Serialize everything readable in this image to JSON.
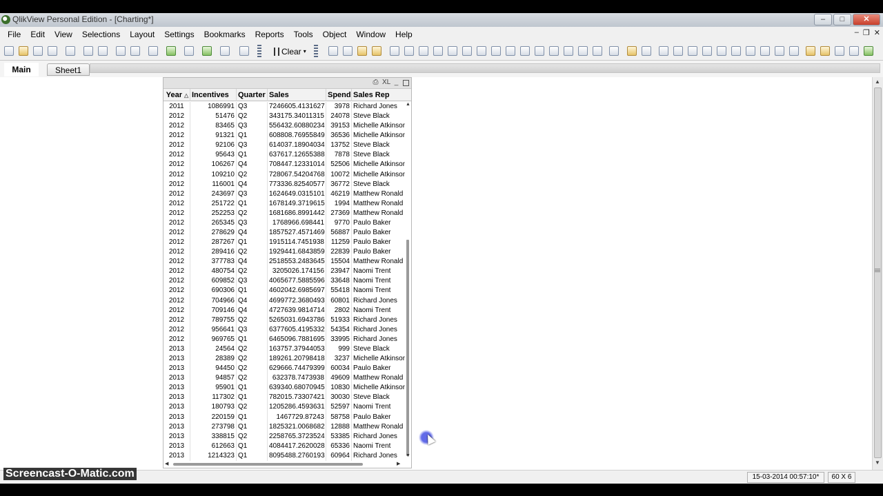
{
  "window": {
    "title": "QlikView Personal Edition - [Charting*]",
    "buttons": {
      "minimize": "–",
      "maximize": "□",
      "close": "✕"
    }
  },
  "menu": {
    "items": [
      "File",
      "Edit",
      "View",
      "Selections",
      "Layout",
      "Settings",
      "Bookmarks",
      "Reports",
      "Tools",
      "Object",
      "Window",
      "Help"
    ],
    "mdi": {
      "minimize": "–",
      "restore": "❐",
      "close": "✕"
    }
  },
  "toolbar": {
    "clear_label": "Clear",
    "clear_arrow": "▾"
  },
  "tabs": {
    "main": "Main",
    "sheet1": "Sheet1"
  },
  "table": {
    "caption_icons": {
      "xl": "XL",
      "minimize": "_"
    },
    "sort_icon": "△",
    "headers": [
      "Year",
      "Incentives",
      "Quarter",
      "Sales",
      "Spend",
      "Sales Rep"
    ],
    "rows": [
      [
        "2011",
        "1086991",
        "Q3",
        "7246605.4131627",
        "3978",
        "Richard Jones"
      ],
      [
        "2012",
        "51476",
        "Q2",
        "343175.34011315",
        "24078",
        "Steve Black"
      ],
      [
        "2012",
        "83465",
        "Q3",
        "556432.60880234",
        "39153",
        "Michelle Atkinson"
      ],
      [
        "2012",
        "91321",
        "Q1",
        "608808.76955849",
        "36536",
        "Michelle Atkinson"
      ],
      [
        "2012",
        "92106",
        "Q3",
        "614037.18904034",
        "13752",
        "Steve Black"
      ],
      [
        "2012",
        "95643",
        "Q1",
        "637617.12655388",
        "7878",
        "Steve Black"
      ],
      [
        "2012",
        "106267",
        "Q4",
        "708447.12331014",
        "52506",
        "Michelle Atkinson"
      ],
      [
        "2012",
        "109210",
        "Q2",
        "728067.54204768",
        "10072",
        "Michelle Atkinson"
      ],
      [
        "2012",
        "116001",
        "Q4",
        "773336.82540577",
        "36772",
        "Steve Black"
      ],
      [
        "2012",
        "243697",
        "Q3",
        "1624649.0315101",
        "46219",
        "Matthew Ronald"
      ],
      [
        "2012",
        "251722",
        "Q1",
        "1678149.3719615",
        "1994",
        "Matthew Ronald"
      ],
      [
        "2012",
        "252253",
        "Q2",
        "1681686.8991442",
        "27369",
        "Matthew Ronald"
      ],
      [
        "2012",
        "265345",
        "Q3",
        "1768966.698441",
        "9770",
        "Paulo Baker"
      ],
      [
        "2012",
        "278629",
        "Q4",
        "1857527.4571469",
        "56887",
        "Paulo Baker"
      ],
      [
        "2012",
        "287267",
        "Q1",
        "1915114.7451938",
        "11259",
        "Paulo Baker"
      ],
      [
        "2012",
        "289416",
        "Q2",
        "1929441.6843859",
        "22839",
        "Paulo Baker"
      ],
      [
        "2012",
        "377783",
        "Q4",
        "2518553.2483645",
        "15504",
        "Matthew Ronald"
      ],
      [
        "2012",
        "480754",
        "Q2",
        "3205026.174156",
        "23947",
        "Naomi Trent"
      ],
      [
        "2012",
        "609852",
        "Q3",
        "4065677.5885596",
        "33648",
        "Naomi Trent"
      ],
      [
        "2012",
        "690306",
        "Q1",
        "4602042.6985697",
        "55418",
        "Naomi Trent"
      ],
      [
        "2012",
        "704966",
        "Q4",
        "4699772.3680493",
        "60801",
        "Richard Jones"
      ],
      [
        "2012",
        "709146",
        "Q4",
        "4727639.9814714",
        "2802",
        "Naomi Trent"
      ],
      [
        "2012",
        "789755",
        "Q2",
        "5265031.6943786",
        "51933",
        "Richard Jones"
      ],
      [
        "2012",
        "956641",
        "Q3",
        "6377605.4195332",
        "54354",
        "Richard Jones"
      ],
      [
        "2012",
        "969765",
        "Q1",
        "6465096.7881695",
        "33995",
        "Richard Jones"
      ],
      [
        "2013",
        "24564",
        "Q2",
        "163757.37944053",
        "999",
        "Steve Black"
      ],
      [
        "2013",
        "28389",
        "Q2",
        "189261.20798418",
        "3237",
        "Michelle Atkinson"
      ],
      [
        "2013",
        "94450",
        "Q2",
        "629666.74479399",
        "60034",
        "Paulo Baker"
      ],
      [
        "2013",
        "94857",
        "Q2",
        "632378.7473938",
        "49609",
        "Matthew Ronald"
      ],
      [
        "2013",
        "95901",
        "Q1",
        "639340.68070945",
        "10830",
        "Michelle Atkinson"
      ],
      [
        "2013",
        "117302",
        "Q1",
        "782015.73307421",
        "30030",
        "Steve Black"
      ],
      [
        "2013",
        "180793",
        "Q2",
        "1205286.4593631",
        "52597",
        "Naomi Trent"
      ],
      [
        "2013",
        "220159",
        "Q1",
        "1467729.87243",
        "58758",
        "Paulo Baker"
      ],
      [
        "2013",
        "273798",
        "Q1",
        "1825321.0068682",
        "12888",
        "Matthew Ronald"
      ],
      [
        "2013",
        "338815",
        "Q2",
        "2258765.3723524",
        "53385",
        "Richard Jones"
      ],
      [
        "2013",
        "612663",
        "Q1",
        "4084417.2620028",
        "65336",
        "Naomi Trent"
      ],
      [
        "2013",
        "1214323",
        "Q1",
        "8095488.2760193",
        "60964",
        "Richard Jones"
      ]
    ]
  },
  "status": {
    "datetime": "15-03-2014 00:57:10*",
    "dims": "60 X 6"
  },
  "watermark": "Screencast-O-Matic.com"
}
